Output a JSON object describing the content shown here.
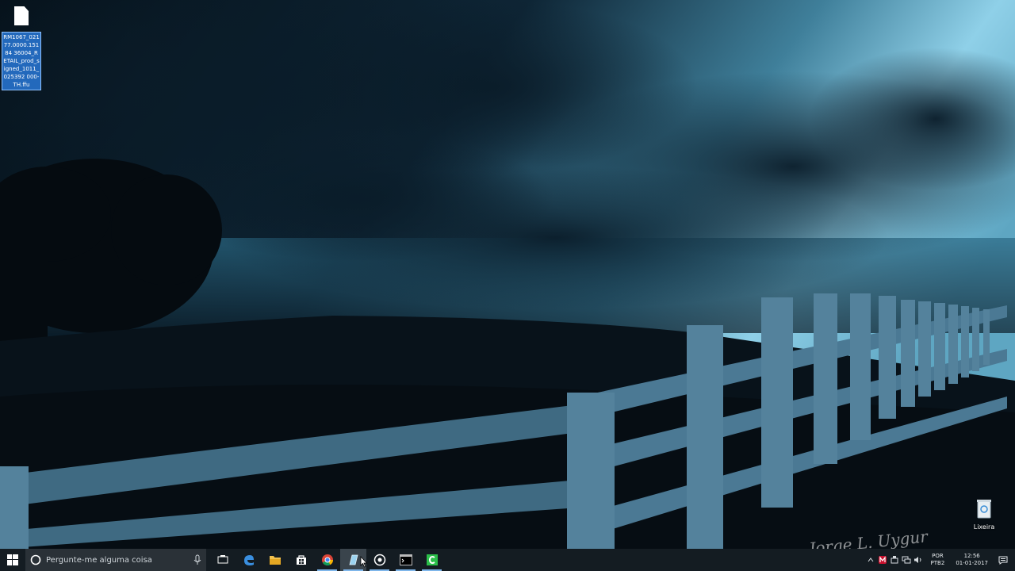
{
  "desktop": {
    "file_icon": {
      "label": "RM1067_02177.0000.15184 36004_RETAIL_prod_signed_1011_025392 000-TH.ffu"
    },
    "recycle_bin": {
      "label": "Lixeira"
    }
  },
  "taskbar": {
    "search_placeholder": "Pergunte-me alguma coisa",
    "apps": [
      {
        "icon": "task-view-icon"
      },
      {
        "icon": "edge-icon"
      },
      {
        "icon": "file-explorer-icon"
      },
      {
        "icon": "store-icon"
      },
      {
        "icon": "chrome-icon"
      },
      {
        "icon": "flash-tool-icon"
      },
      {
        "icon": "settings-circle-icon"
      },
      {
        "icon": "command-prompt-icon"
      },
      {
        "icon": "green-app-icon"
      }
    ],
    "tray": {
      "language_top": "POR",
      "language_bottom": "PTB2",
      "time": "12:56",
      "date": "01-01-2017"
    }
  },
  "colors": {
    "taskbar": "#141c22",
    "search_box": "#2a3137",
    "accent": "#7fb6ea",
    "sky_light": "#8fd0e8",
    "cloud_dark": "#0e2433"
  }
}
